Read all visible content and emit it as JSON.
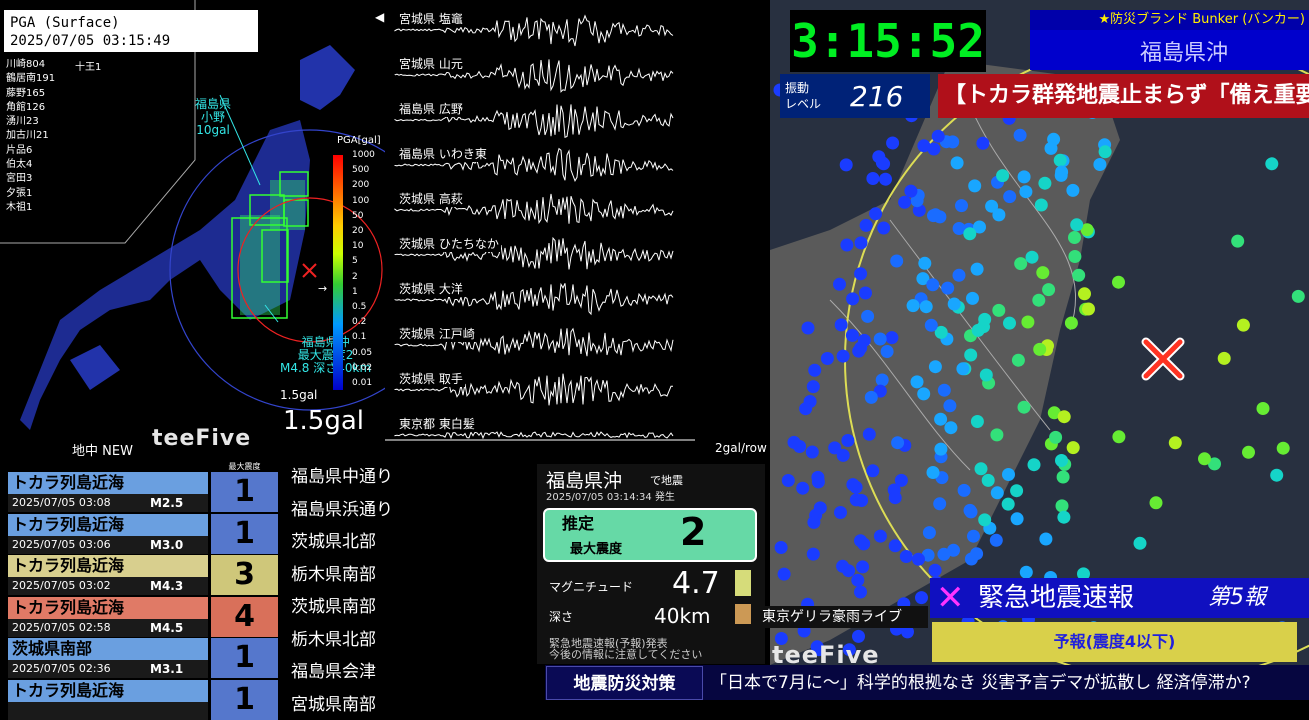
{
  "pga_panel": {
    "line1": "PGA (Surface)",
    "line2": "2025/07/05 03:15:49",
    "top_station": "十王1",
    "stations": [
      "川崎804",
      "鶴居南191",
      "藤野165",
      "角館126",
      "湧川23",
      "加古川21",
      "片品6",
      "伯太4",
      "宮田3",
      "夕張1",
      "木祖1"
    ],
    "marker_label_1": "福島県",
    "marker_label_2": "小野",
    "marker_label_3": "10gal",
    "epicenter_1": "福島県沖",
    "epicenter_2": "最大震度2",
    "epicenter_3": "M4.8 深さ40km",
    "legend_title": "PGA[gal]",
    "legend_ticks": [
      "1000",
      "500",
      "200",
      "100",
      "50",
      "20",
      "10",
      "5",
      "2",
      "1",
      "0.5",
      "0.2",
      "0.1",
      "0.05",
      "0.02",
      "0.01"
    ],
    "gal_small": "1.5gal",
    "gal_big": "1.5gal",
    "bottom_label": "地中 NEW",
    "brand": "teeFive"
  },
  "waveforms": {
    "stations": [
      "宮城県 塩竈",
      "宮城県 山元",
      "福島県 広野",
      "福島県 いわき東",
      "茨城県 高萩",
      "茨城県 ひたちなか",
      "茨城県 大洋",
      "茨城県 江戸崎",
      "茨城県 取手",
      "東京都 東白髪"
    ],
    "scale": "2gal/row",
    "arrow": "◀"
  },
  "header": {
    "clock": "3:15:52",
    "brand": "★防災ブランド Bunker (バンカー)",
    "region": "福島県沖",
    "vib_label_1": "振動",
    "vib_label_2": "レベル",
    "vib_value": "216",
    "headline": "【トカラ群発地震止まらず「備え重要」】"
  },
  "eew": {
    "x_mark": "✕",
    "title": "緊急地震速報",
    "report": "第5報",
    "forecast": "予報(震度4以下)"
  },
  "history": {
    "intensity_header": "最大震度",
    "items": [
      {
        "region": "トカラ列島近海",
        "datetime": "2025/07/05 03:08",
        "mag": "M2.5",
        "intensity": "1",
        "color": "#6a9fe0",
        "int_color": "#5577cc"
      },
      {
        "region": "トカラ列島近海",
        "datetime": "2025/07/05 03:06",
        "mag": "M3.0",
        "intensity": "1",
        "color": "#6a9fe0",
        "int_color": "#5577cc"
      },
      {
        "region": "トカラ列島近海",
        "datetime": "2025/07/05 03:02",
        "mag": "M4.3",
        "intensity": "3",
        "color": "#d8cf8e",
        "int_color": "#cfc77a"
      },
      {
        "region": "トカラ列島近海",
        "datetime": "2025/07/05 02:58",
        "mag": "M4.5",
        "intensity": "4",
        "color": "#e07a66",
        "int_color": "#d9705a"
      },
      {
        "region": "茨城県南部",
        "datetime": "2025/07/05 02:36",
        "mag": "M3.1",
        "intensity": "1",
        "color": "#6a9fe0",
        "int_color": "#5577cc"
      },
      {
        "region": "トカラ列島近海",
        "datetime": "",
        "mag": "",
        "intensity": "1",
        "color": "#6a9fe0",
        "int_color": "#5577cc"
      }
    ],
    "prefectures": [
      "福島県中通り",
      "福島県浜通り",
      "茨城県北部",
      "栃木県南部",
      "茨城県南部",
      "栃木県北部",
      "福島県会津",
      "宮城県南部"
    ]
  },
  "event": {
    "title": "福島県沖",
    "suffix": "で地震",
    "time": "2025/07/05 03:14:34 発生",
    "estimate_1": "推定",
    "estimate_2": "最大震度",
    "estimate_value": "2",
    "mag_label": "マグニチュード",
    "mag_value": "4.7",
    "depth_label": "深さ",
    "depth_value": "40km",
    "note_1": "緊急地震速報(予報)発表",
    "note_2": "今後の情報に注意してください",
    "guerrilla": "東京ゲリラ豪雨ライブ",
    "brand": "teeFive"
  },
  "ticker": {
    "tag": "地震防災対策",
    "text": "「日本で7月に～」科学的根拠なき 災害予言デマが拡散し 経済停滞か?"
  }
}
